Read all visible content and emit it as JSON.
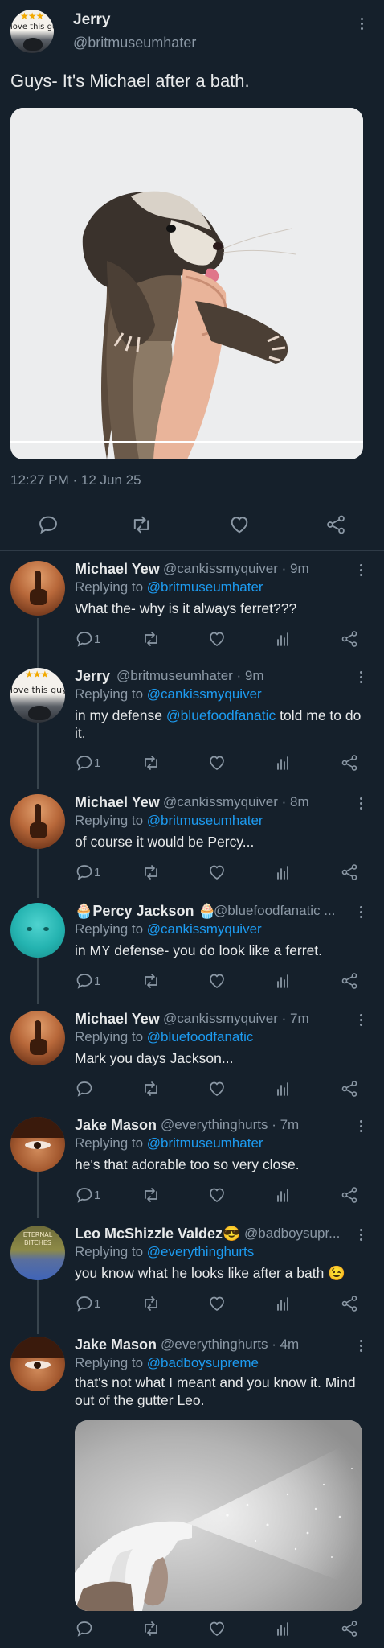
{
  "main": {
    "avatar_text": "love this guy",
    "avatar_stars": "★★★",
    "name": "Jerry",
    "handle": "@britmuseumhater",
    "text": "Guys- It's Michael after a bath.",
    "timestamp": "12:27 PM · 12 Jun 25"
  },
  "replies": [
    {
      "name": "Michael Yew",
      "handle": "@cankissmyquiver · 9m",
      "replying_prefix": "Replying to ",
      "replying_to": "@britmuseumhater",
      "body": "What the- why is it always ferret???",
      "reply_count": "1"
    },
    {
      "name": "Jerry",
      "handle": "@britmuseumhater · 9m",
      "replying_prefix": "Replying to ",
      "replying_to": "@cankissmyquiver",
      "body_prefix": "in my defense ",
      "body_mention": "@bluefoodfanatic",
      "body_suffix": " told me to do it.",
      "reply_count": "1",
      "avatar_text": "love this guy",
      "avatar_stars": "★★★"
    },
    {
      "name": "Michael Yew",
      "handle": "@cankissmyquiver · 8m",
      "replying_prefix": "Replying to ",
      "replying_to": "@britmuseumhater",
      "body": "of course it would be Percy...",
      "reply_count": "1"
    },
    {
      "name": "Percy Jackson",
      "name_emoji": "🧁",
      "handle": "@bluefoodfanatic ...",
      "replying_prefix": "Replying to ",
      "replying_to": "@cankissmyquiver",
      "body": "in MY defense- you do look like a ferret.",
      "reply_count": "1"
    },
    {
      "name": "Michael Yew",
      "handle": "@cankissmyquiver · 7m",
      "replying_prefix": "Replying to ",
      "replying_to": "@bluefoodfanatic",
      "body": "Mark you days Jackson..."
    },
    {
      "name": "Jake Mason",
      "handle": "@everythinghurts · 7m",
      "replying_prefix": "Replying to ",
      "replying_to": "@britmuseumhater",
      "body": "he's that adorable too so very close.",
      "reply_count": "1"
    },
    {
      "name": "Leo McShizzle Valdez😎",
      "handle": "@badboysupr...",
      "replying_prefix": "Replying to ",
      "replying_to": "@everythinghurts",
      "body": "you know what he looks like after a bath 😉",
      "reply_count": "1",
      "avatar_line1": "ETERNAL",
      "avatar_line2": "BITCHES"
    },
    {
      "name": "Jake Mason",
      "handle": "@everythinghurts · 4m",
      "replying_prefix": "Replying to ",
      "replying_to": "@badboysupreme",
      "body": "that's not what I meant and you know it. Mind out of the gutter Leo."
    }
  ],
  "colors": {
    "background": "#15202b",
    "text": "#e7e9ea",
    "secondary": "#8b98a5",
    "link": "#1d9bf0",
    "separator": "#2f3b47"
  },
  "icons": [
    "reply-icon",
    "retweet-icon",
    "like-icon",
    "analytics-icon",
    "share-icon",
    "more-icon"
  ]
}
